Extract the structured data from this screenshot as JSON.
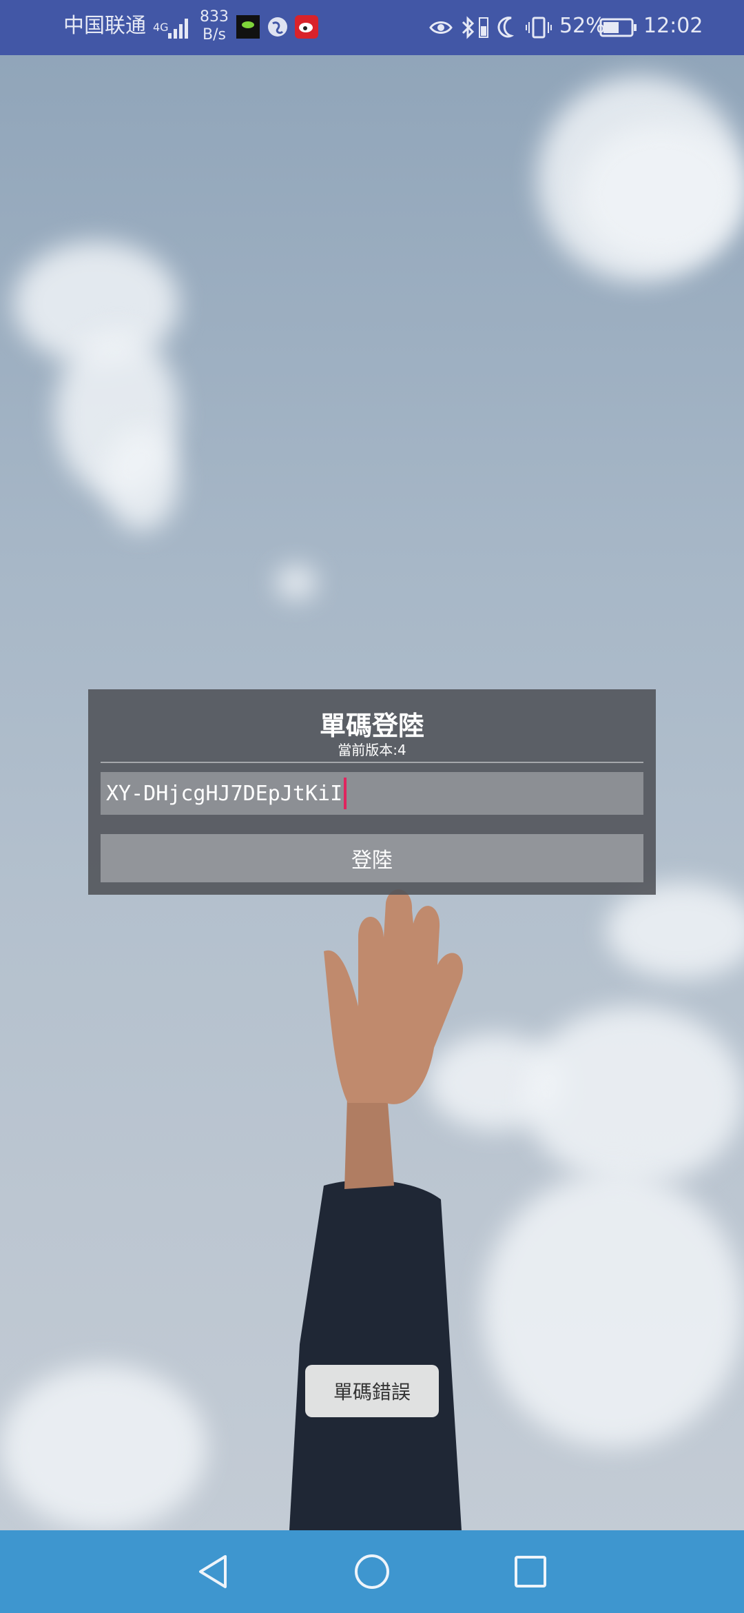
{
  "status_bar": {
    "carrier": "中国联通",
    "network_type": "4G",
    "net_speed_value": "833",
    "net_speed_unit": "B/s",
    "battery_percent": "52%",
    "time": "12:02"
  },
  "login": {
    "title": "單碼登陸",
    "version_label": "當前版本:4",
    "code_value": "XY-DHjcgHJ7DEpJtKiI",
    "login_button": "登陸"
  },
  "toast": {
    "message": "單碼錯誤"
  },
  "nav": {
    "back_icon": "triangle-back-icon",
    "home_icon": "circle-home-icon",
    "recents_icon": "square-recents-icon"
  },
  "colors": {
    "status_bar": "#4257a6",
    "nav_bar": "#3e96cf",
    "caret": "#e0245e"
  }
}
